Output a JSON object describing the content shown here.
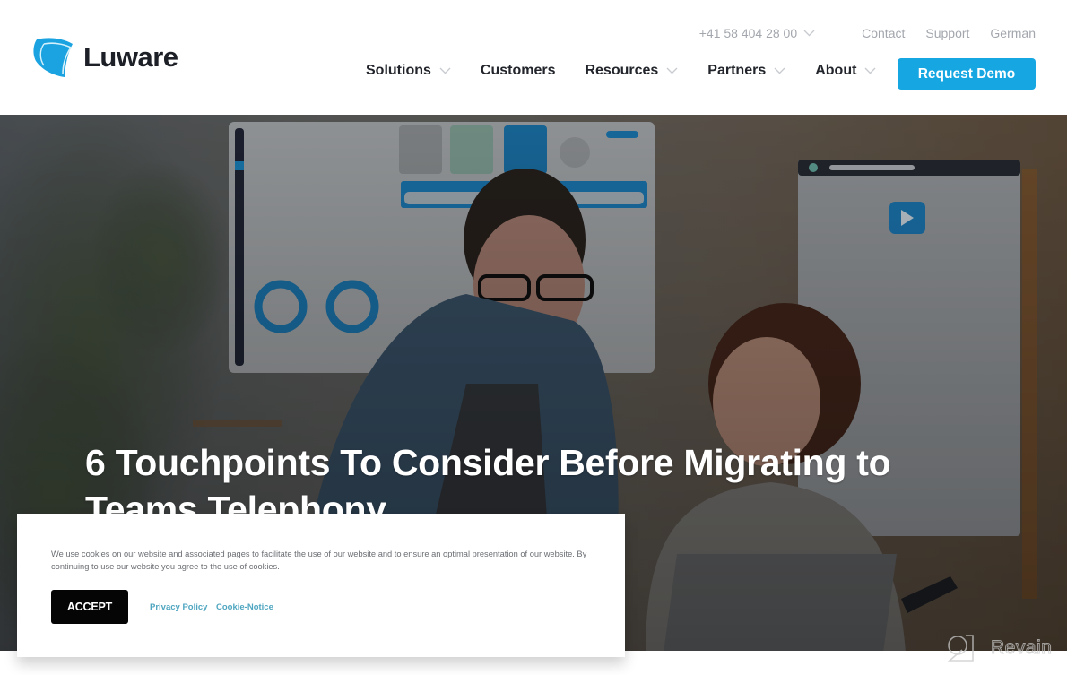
{
  "brand": {
    "name": "Luware",
    "accent_color": "#16a7e3"
  },
  "topbar": {
    "phone": "+41 58 404 28 00",
    "links": [
      "Contact",
      "Support",
      "German"
    ]
  },
  "nav": {
    "items": [
      {
        "label": "Solutions",
        "has_dropdown": true
      },
      {
        "label": "Customers",
        "has_dropdown": false
      },
      {
        "label": "Resources",
        "has_dropdown": true
      },
      {
        "label": "Partners",
        "has_dropdown": true
      },
      {
        "label": "About",
        "has_dropdown": true
      }
    ],
    "cta_label": "Request Demo"
  },
  "hero": {
    "title": "6 Touchpoints To Consider Before Migrating to Teams Telephony",
    "image_description": "Smiling man in denim shirt and glasses leaning over a woman at a laptop, with dashboard screens and plants in the background"
  },
  "cookie_banner": {
    "text": "We use cookies on our website and associated pages to facilitate the use of our website and to ensure an optimal presentation of our website. By continuing to use our website you agree to the use of cookies.",
    "accept_label": "ACCEPT",
    "privacy_label": "Privacy Policy",
    "notice_label": "Cookie-Notice"
  },
  "watermark": {
    "text": "Revain"
  }
}
